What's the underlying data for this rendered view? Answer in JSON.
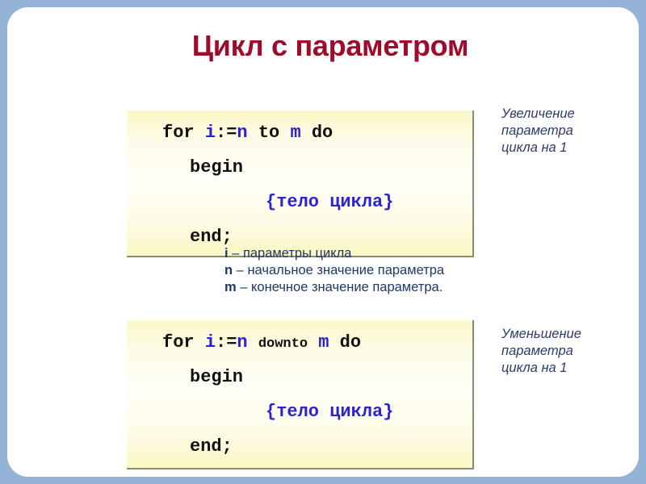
{
  "slide": {
    "title": "Цикл с параметром",
    "title_color": "#9e0b2b",
    "frame_color": "#95b3d7",
    "background_color": "#ffffff"
  },
  "code_blocks": [
    {
      "id": "for-to-block",
      "background_color": "#fdfbe4",
      "accent_color": "#2a22d4",
      "lines": [
        {
          "id": "line-for",
          "parts": [
            {
              "text": "for ",
              "style": "plain"
            },
            {
              "text": "i",
              "style": "blue"
            },
            {
              "text": ":=",
              "style": "plain"
            },
            {
              "text": "n",
              "style": "blue"
            },
            {
              "text": " to ",
              "style": "plain"
            },
            {
              "text": "m",
              "style": "blue"
            },
            {
              "text": " do",
              "style": "plain"
            }
          ]
        },
        {
          "id": "line-begin",
          "parts": [
            {
              "text": "begin",
              "style": "plain"
            }
          ]
        },
        {
          "id": "line-body",
          "parts": [
            {
              "text": "{тело цикла}",
              "style": "blue"
            }
          ]
        },
        {
          "id": "line-end",
          "parts": [
            {
              "text": "end;",
              "style": "plain"
            }
          ]
        }
      ]
    },
    {
      "id": "for-downto-block",
      "background_color": "#fdfbe4",
      "accent_color": "#2a22d4",
      "lines": [
        {
          "id": "line-for",
          "parts": [
            {
              "text": "for ",
              "style": "plain"
            },
            {
              "text": "i",
              "style": "blue"
            },
            {
              "text": ":=",
              "style": "plain"
            },
            {
              "text": "n",
              "style": "blue"
            },
            {
              "text": " ",
              "style": "plain"
            },
            {
              "text": "downto",
              "style": "small"
            },
            {
              "text": " ",
              "style": "plain"
            },
            {
              "text": "m",
              "style": "blue"
            },
            {
              "text": " do",
              "style": "plain"
            }
          ]
        },
        {
          "id": "line-begin",
          "parts": [
            {
              "text": "begin",
              "style": "plain"
            }
          ]
        },
        {
          "id": "line-body",
          "parts": [
            {
              "text": "{тело цикла}",
              "style": "blue"
            }
          ]
        },
        {
          "id": "line-end",
          "parts": [
            {
              "text": "end;",
              "style": "plain"
            }
          ]
        }
      ]
    }
  ],
  "legend": {
    "color": "#1f3864",
    "rows": [
      {
        "symbol": "i",
        "dash": " – ",
        "description": "параметры цикла"
      },
      {
        "symbol": "n",
        "dash": " – ",
        "description": "начальное значение параметра"
      },
      {
        "symbol": "m",
        "dash": " – ",
        "description": "конечное значение параметра."
      }
    ]
  },
  "notes": [
    {
      "id": "note-increase",
      "color": "#2d3a6b",
      "lines": [
        "Увеличение",
        "параметра",
        "цикла на 1"
      ]
    },
    {
      "id": "note-decrease",
      "color": "#2d3a6b",
      "lines": [
        "Уменьшение",
        "параметра",
        "цикла на 1"
      ]
    }
  ]
}
